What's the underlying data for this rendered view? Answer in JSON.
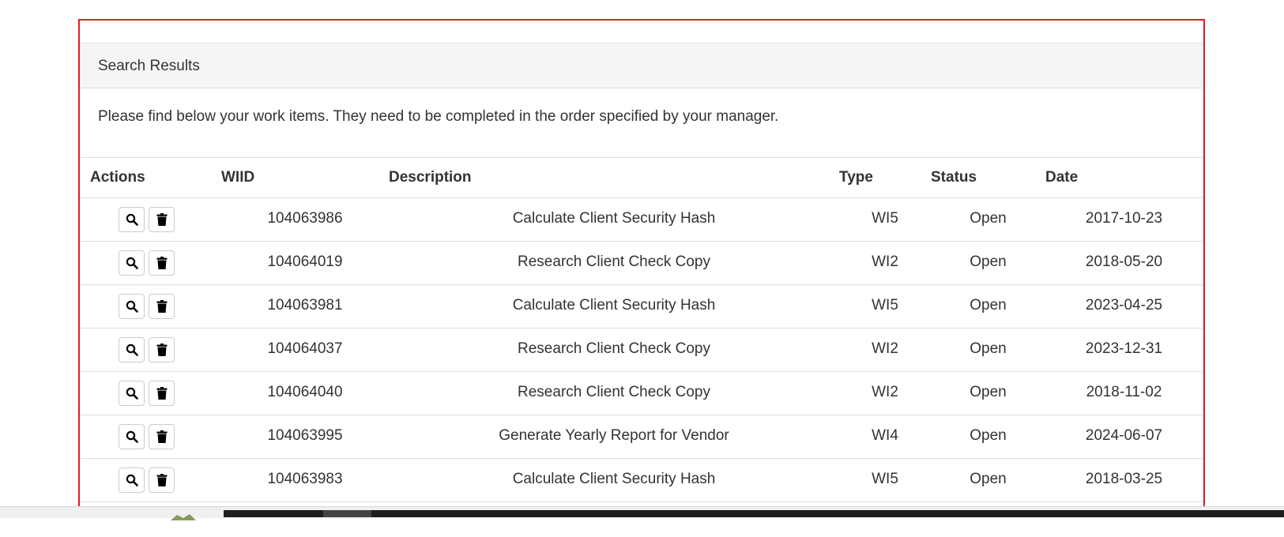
{
  "panel": {
    "title": "Search Results",
    "intro": "Please find below your work items. They need to be completed in the order specified by your manager."
  },
  "table": {
    "headers": {
      "actions": "Actions",
      "wiid": "WIID",
      "description": "Description",
      "type": "Type",
      "status": "Status",
      "date": "Date"
    },
    "rows": [
      {
        "wiid": "104063986",
        "description": "Calculate Client Security Hash",
        "type": "WI5",
        "status": "Open",
        "date": "2017-10-23"
      },
      {
        "wiid": "104064019",
        "description": "Research Client Check Copy",
        "type": "WI2",
        "status": "Open",
        "date": "2018-05-20"
      },
      {
        "wiid": "104063981",
        "description": "Calculate Client Security Hash",
        "type": "WI5",
        "status": "Open",
        "date": "2023-04-25"
      },
      {
        "wiid": "104064037",
        "description": "Research Client Check Copy",
        "type": "WI2",
        "status": "Open",
        "date": "2023-12-31"
      },
      {
        "wiid": "104064040",
        "description": "Research Client Check Copy",
        "type": "WI2",
        "status": "Open",
        "date": "2018-11-02"
      },
      {
        "wiid": "104063995",
        "description": "Generate Yearly Report for Vendor",
        "type": "WI4",
        "status": "Open",
        "date": "2024-06-07"
      },
      {
        "wiid": "104063983",
        "description": "Calculate Client Security Hash",
        "type": "WI5",
        "status": "Open",
        "date": "2018-03-25"
      }
    ],
    "row_actions": {
      "view_icon": "search-icon",
      "delete_icon": "trash-icon"
    }
  },
  "colors": {
    "highlight_frame": "#e51c23",
    "heading_background": "#f5f5f5",
    "border": "#dddddd",
    "text": "#333333"
  }
}
